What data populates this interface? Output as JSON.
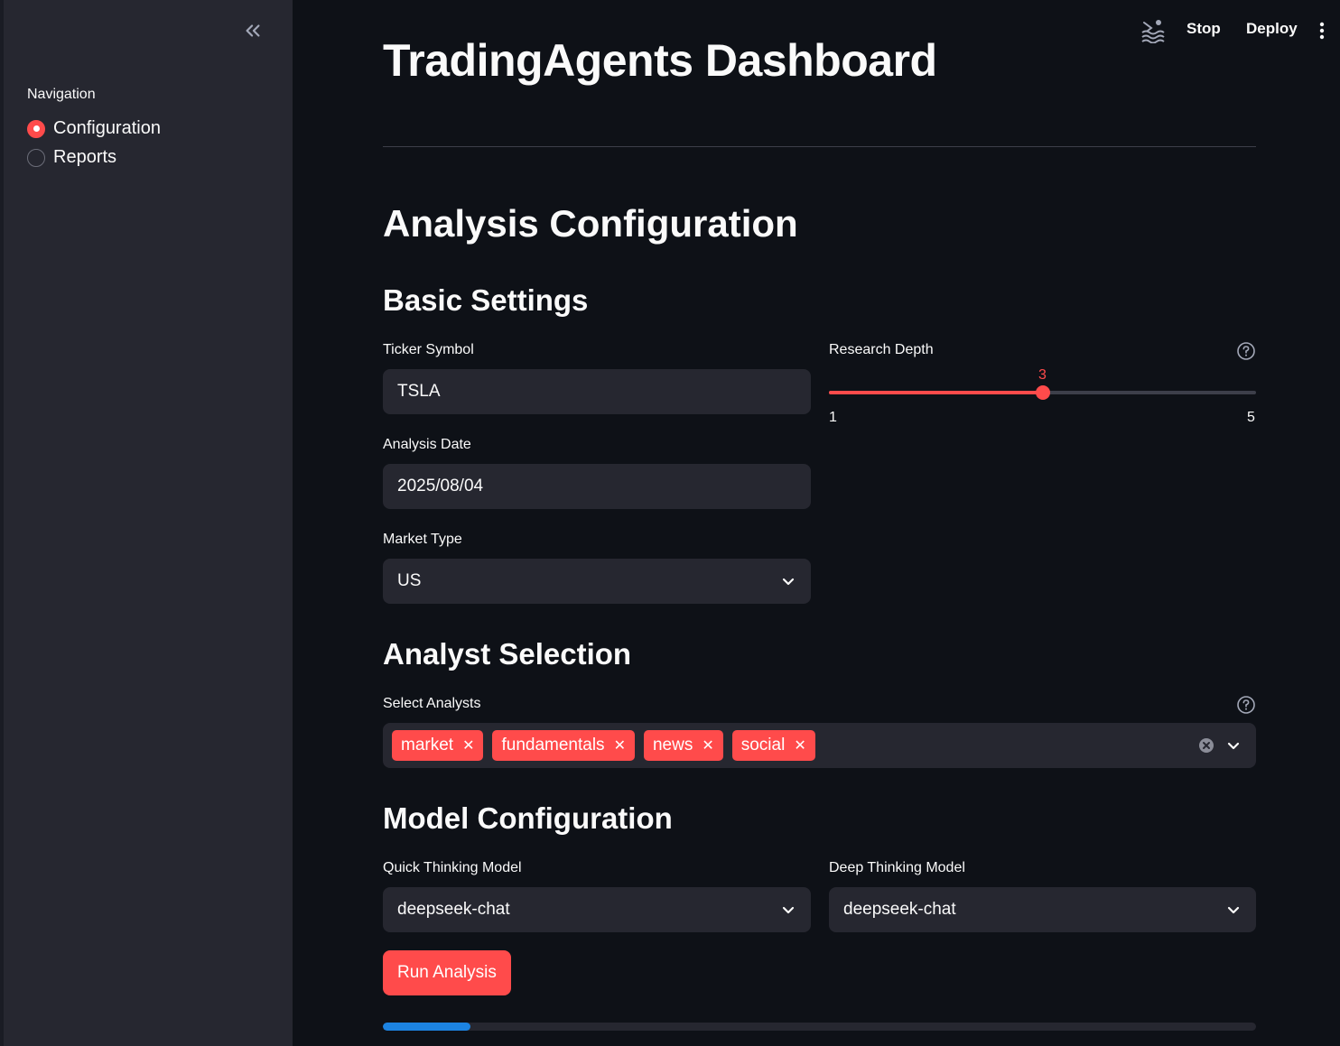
{
  "sidebar": {
    "nav_label": "Navigation",
    "options": [
      {
        "label": "Configuration",
        "selected": true
      },
      {
        "label": "Reports",
        "selected": false
      }
    ]
  },
  "header": {
    "stop_label": "Stop",
    "deploy_label": "Deploy"
  },
  "main": {
    "title": "TradingAgents Dashboard",
    "section_title": "Analysis Configuration",
    "basic": {
      "heading": "Basic Settings",
      "ticker_label": "Ticker Symbol",
      "ticker_value": "TSLA",
      "date_label": "Analysis Date",
      "date_value": "2025/08/04",
      "market_label": "Market Type",
      "market_value": "US",
      "depth_label": "Research Depth",
      "depth_value": 3,
      "depth_min": 1,
      "depth_max": 5
    },
    "analysts": {
      "heading": "Analyst Selection",
      "label": "Select Analysts",
      "selected": [
        "market",
        "fundamentals",
        "news",
        "social"
      ]
    },
    "model": {
      "heading": "Model Configuration",
      "quick_label": "Quick Thinking Model",
      "quick_value": "deepseek-chat",
      "deep_label": "Deep Thinking Model",
      "deep_value": "deepseek-chat"
    },
    "run_label": "Run Analysis",
    "progress": 0.1
  },
  "colors": {
    "accent": "#ff4b4b",
    "progress": "#1c83e1",
    "background": "#0e1117",
    "sidebar": "#262730"
  }
}
